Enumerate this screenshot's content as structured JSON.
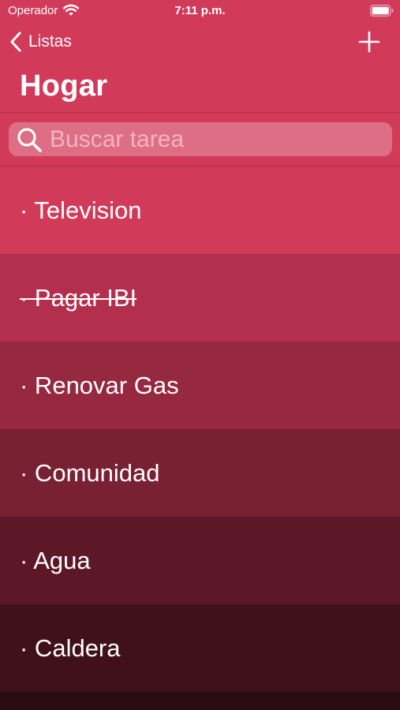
{
  "status_bar": {
    "carrier": "Operador",
    "time": "7:11 p.m.",
    "wifi_icon": "wifi-icon",
    "battery_icon": "battery-icon"
  },
  "nav": {
    "back_label": "Listas",
    "back_icon": "chevron-left-icon",
    "add_icon": "plus-icon"
  },
  "title": "Hogar",
  "search": {
    "placeholder": "Buscar tarea",
    "value": "",
    "icon": "search-icon"
  },
  "tasks": [
    {
      "label": "· Television",
      "completed": false
    },
    {
      "label": "· Pagar IBI",
      "completed": true
    },
    {
      "label": "· Renovar Gas",
      "completed": false
    },
    {
      "label": "· Comunidad",
      "completed": false
    },
    {
      "label": "· Agua",
      "completed": false
    },
    {
      "label": "· Caldera",
      "completed": false
    }
  ],
  "colors": {
    "accent": "#d23a5a",
    "search_field": "#de6e85",
    "row_gradient": [
      "#d23a5a",
      "#b32f4d",
      "#962840",
      "#792033",
      "#5c1827",
      "#40111b"
    ],
    "background_bottom": "#2a0c12"
  }
}
